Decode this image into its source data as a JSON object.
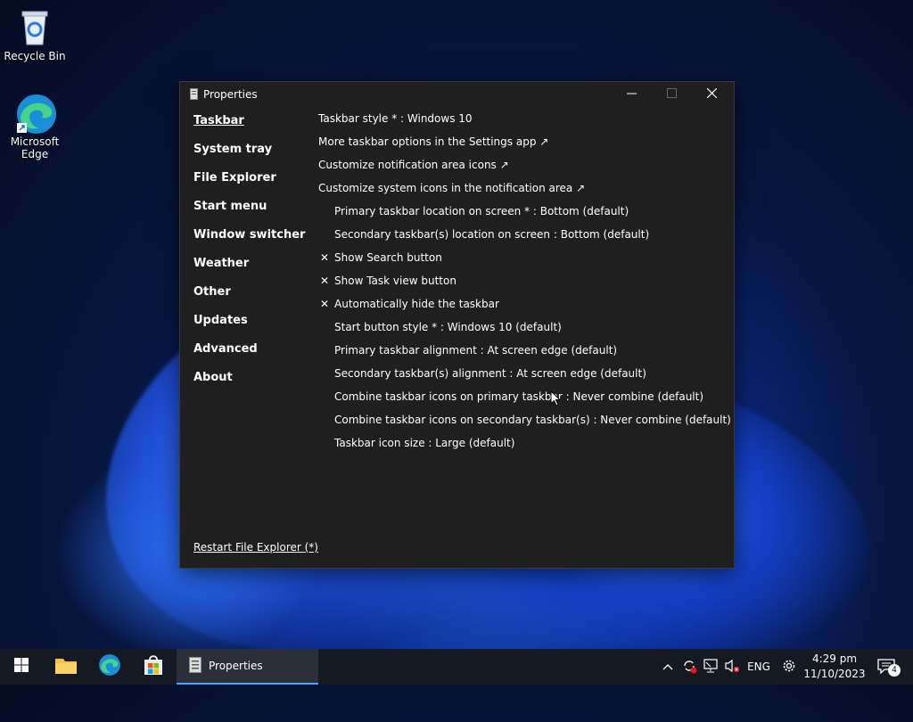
{
  "desktop": {
    "icons": [
      {
        "label": "Recycle Bin"
      },
      {
        "label": "Microsoft Edge"
      }
    ]
  },
  "window": {
    "title": "Properties",
    "nav": [
      {
        "label": "Taskbar",
        "active": true
      },
      {
        "label": "System tray"
      },
      {
        "label": "File Explorer"
      },
      {
        "label": "Start menu"
      },
      {
        "label": "Window switcher"
      },
      {
        "label": "Weather"
      },
      {
        "label": "Other"
      },
      {
        "label": "Updates"
      },
      {
        "label": "Advanced"
      },
      {
        "label": "About"
      }
    ],
    "settings": [
      {
        "label": "Taskbar style * : Windows 10"
      },
      {
        "label": "More taskbar options in the Settings app ↗"
      },
      {
        "label": "Customize notification area icons ↗"
      },
      {
        "label": "Customize system icons in the notification area ↗"
      },
      {
        "label": "Primary taskbar location on screen * : Bottom (default)"
      },
      {
        "label": "Secondary taskbar(s) location on screen : Bottom (default)"
      },
      {
        "label": "Show Search button",
        "mark": "✕"
      },
      {
        "label": "Show Task view button",
        "mark": "✕"
      },
      {
        "label": "Automatically hide the taskbar",
        "mark": "✕"
      },
      {
        "label": "Start button style * : Windows 10 (default)"
      },
      {
        "label": "Primary taskbar alignment : At screen edge (default)"
      },
      {
        "label": "Secondary taskbar(s) alignment : At screen edge (default)"
      },
      {
        "label": "Combine taskbar icons on primary taskbar : Never combine (default)"
      },
      {
        "label": "Combine taskbar icons on secondary taskbar(s) : Never combine (default)"
      },
      {
        "label": "Taskbar icon size : Large (default)"
      }
    ],
    "restart_link": "Restart File Explorer (*)"
  },
  "taskbar": {
    "active_app": "Properties",
    "language": "ENG",
    "time": "4:29 pm",
    "date": "11/10/2023",
    "notification_count": "4",
    "accent_color": "#4aa3ff"
  }
}
